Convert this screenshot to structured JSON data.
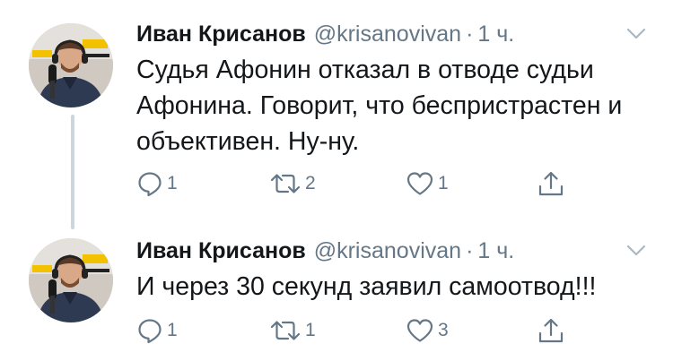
{
  "tweets": [
    {
      "author_name": "Иван Крисанов",
      "handle": "@krisanovivan",
      "separator": "·",
      "time": "1 ч.",
      "text": "Судья Афонин отказал в отводе судьи Афонина. Говорит, что беспристрастен и объективен. Ну-ну.",
      "replies": "1",
      "retweets": "2",
      "likes": "1"
    },
    {
      "author_name": "Иван Крисанов",
      "handle": "@krisanovivan",
      "separator": "·",
      "time": "1 ч.",
      "text": "И через 30 секунд заявил самоотвод!!!",
      "replies": "1",
      "retweets": "1",
      "likes": "3"
    }
  ],
  "icons": {
    "reply": "reply-icon",
    "retweet": "retweet-icon",
    "like": "like-icon",
    "share": "share-icon",
    "caret": "chevron-down-icon"
  },
  "colors": {
    "text": "#14171a",
    "secondary": "#657786",
    "icon": "#657786",
    "thread_line": "#ccd6dd"
  }
}
